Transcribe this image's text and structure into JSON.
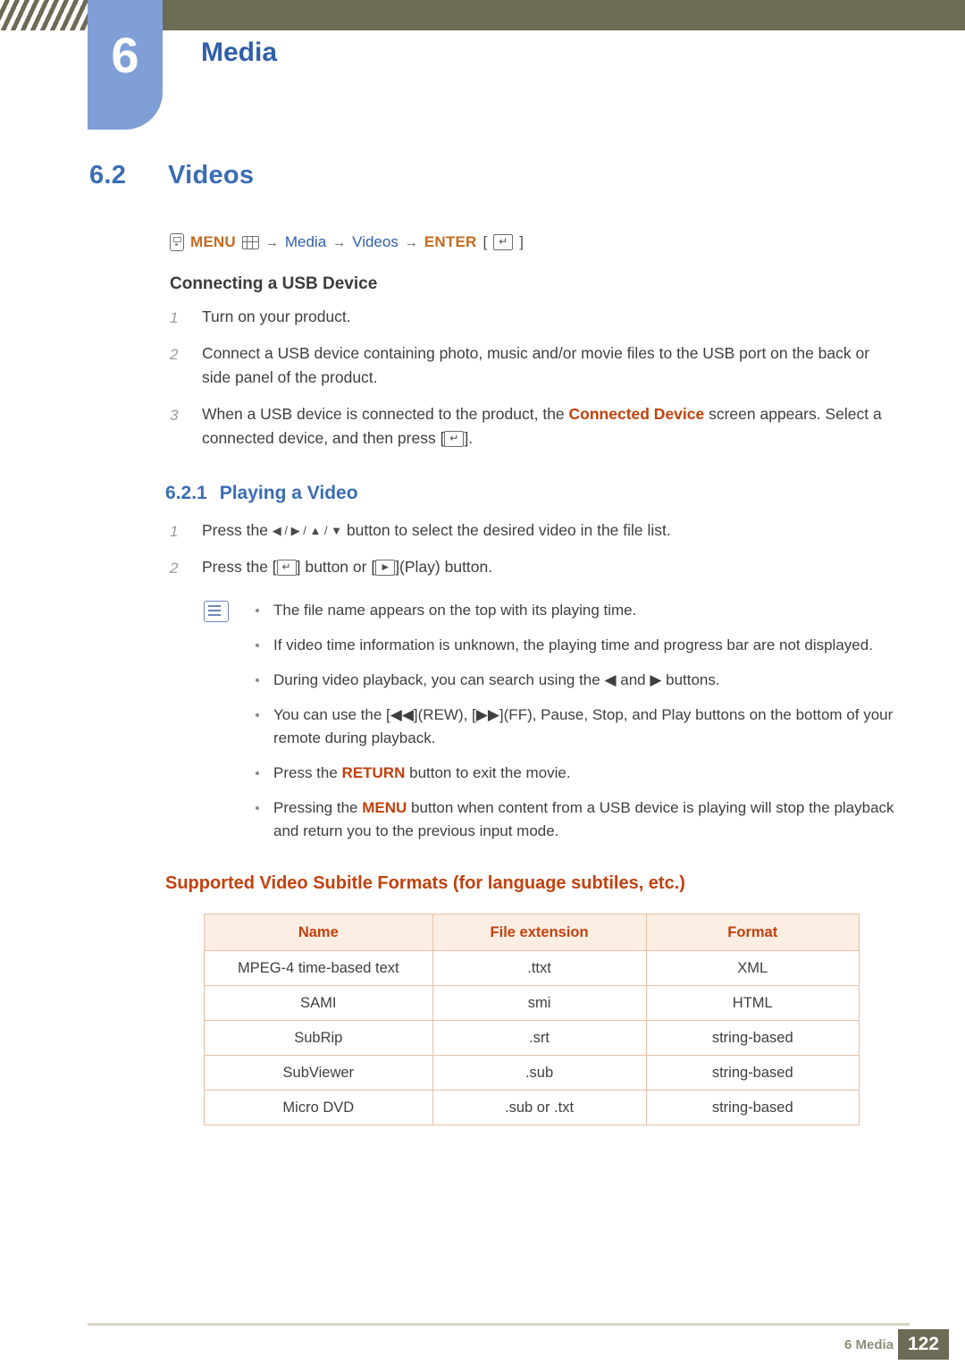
{
  "header": {
    "chapter_number": "6",
    "chapter_title": "Media"
  },
  "section": {
    "number": "6.2",
    "title": "Videos"
  },
  "menu_path": {
    "remote_icon": "remote-icon",
    "menu_label": "MENU",
    "grid_icon": "grid-icon",
    "arrow1": "→",
    "item1": "Media",
    "arrow2": "→",
    "item2": "Videos",
    "arrow3": "→",
    "enter_label": "ENTER",
    "enter_bracket_open": "[",
    "enter_bracket_close": "]",
    "enter_icon": "↵"
  },
  "usb": {
    "heading": "Connecting a USB Device",
    "steps": [
      {
        "n": "1",
        "text": "Turn on your product."
      },
      {
        "n": "2",
        "text": "Connect a USB device containing photo, music and/or movie files to the USB port on the back or side panel of the product."
      },
      {
        "n": "3",
        "text_before": "When a USB device is connected to the product, the ",
        "highlight": "Connected Device",
        "text_after": " screen appears. Select a connected device, and then press [",
        "text_end": "]."
      }
    ]
  },
  "playing": {
    "number": "6.2.1",
    "title": "Playing a Video",
    "step1_before": "Press the ",
    "step1_buttons": "◀ / ▶ / ▲ / ▼",
    "step1_after": " button to select the desired video in the file list.",
    "step2_before": "Press the [",
    "step2_mid": "] button or [",
    "step2_after": "](Play) button."
  },
  "notes": [
    {
      "text": "The file name appears on the top with its playing time."
    },
    {
      "text": "If video time information is unknown, the playing time and progress bar are not displayed."
    },
    {
      "text": "During video playback, you can search using the ◀ and ▶ buttons."
    },
    {
      "text": "You can use the [◀◀](REW), [▶▶](FF), Pause, Stop, and Play buttons on the bottom of your remote during playback."
    },
    {
      "text": "Press the RETURN button to exit the movie.",
      "kw": "RETURN"
    },
    {
      "text": "Pressing the MENU button when content from a USB device is playing will stop the playback and return you to the previous input mode.",
      "kw": "MENU"
    }
  ],
  "subtitle_table": {
    "heading": "Supported Video Subitle Formats (for language subtiles, etc.)",
    "columns": [
      "Name",
      "File extension",
      "Format"
    ],
    "rows": [
      [
        "MPEG-4 time-based text",
        ".ttxt",
        "XML"
      ],
      [
        "SAMI",
        "smi",
        "HTML"
      ],
      [
        "SubRip",
        ".srt",
        "string-based"
      ],
      [
        "SubViewer",
        ".sub",
        "string-based"
      ],
      [
        "Micro DVD",
        ".sub or .txt",
        "string-based"
      ]
    ]
  },
  "footer": {
    "label": "6 Media",
    "page": "122"
  },
  "colors": {
    "header_bar": "#6d6a55",
    "badge": "#7f9fd6",
    "heading_blue": "#3a6db5",
    "accent_orange": "#c2410c",
    "table_header_bg": "#fdeee4"
  }
}
